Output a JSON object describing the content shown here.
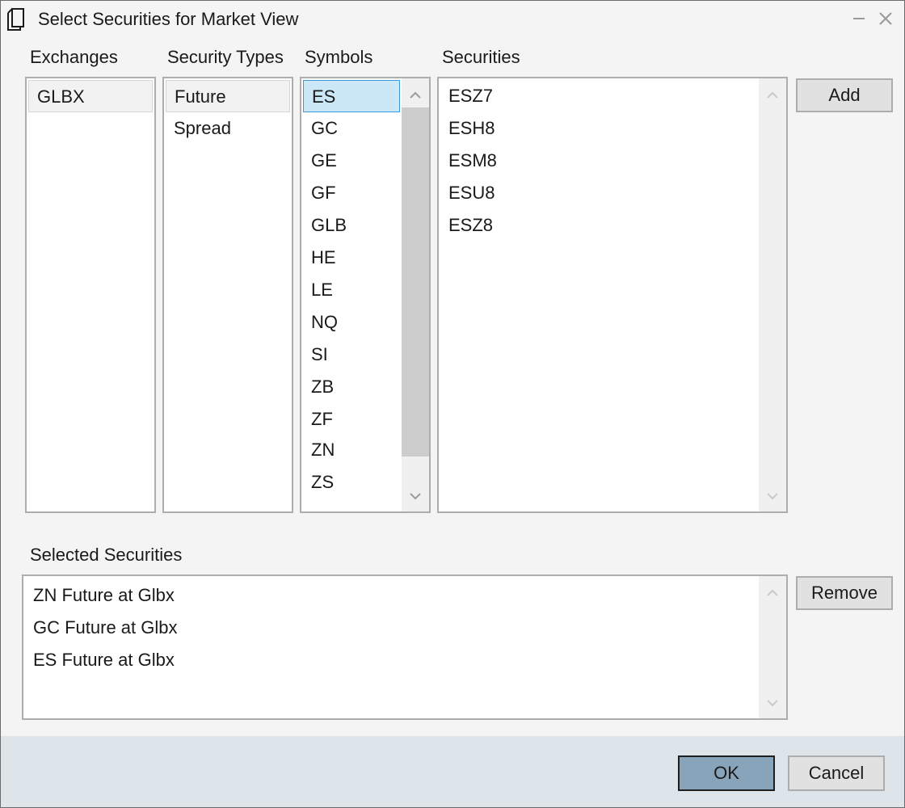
{
  "window": {
    "title": "Select Securities for Market View"
  },
  "columns": {
    "exchanges": "Exchanges",
    "security_types": "Security Types",
    "symbols": "Symbols",
    "securities": "Securities"
  },
  "exchanges": [
    "GLBX"
  ],
  "security_types": [
    "Future",
    "Spread"
  ],
  "symbols": [
    "ES",
    "GC",
    "GE",
    "GF",
    "GLB",
    "HE",
    "LE",
    "NQ",
    "SI",
    "ZB",
    "ZF",
    "ZN",
    "ZS"
  ],
  "securities": [
    "ESZ7",
    "ESH8",
    "ESM8",
    "ESU8",
    "ESZ8"
  ],
  "selected_section": {
    "label": "Selected Securities",
    "items": [
      "ZN Future at Glbx",
      "GC Future at Glbx",
      "ES Future at Glbx"
    ]
  },
  "buttons": {
    "add": "Add",
    "remove": "Remove",
    "ok": "OK",
    "cancel": "Cancel"
  },
  "icons": {
    "title": "document-icon",
    "minimize": "minimize-icon",
    "close": "close-icon",
    "scroll_up": "chevron-up-icon",
    "scroll_down": "chevron-down-icon"
  },
  "colors": {
    "selection_blue": "#cce8f7",
    "selection_border": "#3c9ad9",
    "primary_button": "#88a4ba",
    "footer": "#dde4ea"
  }
}
